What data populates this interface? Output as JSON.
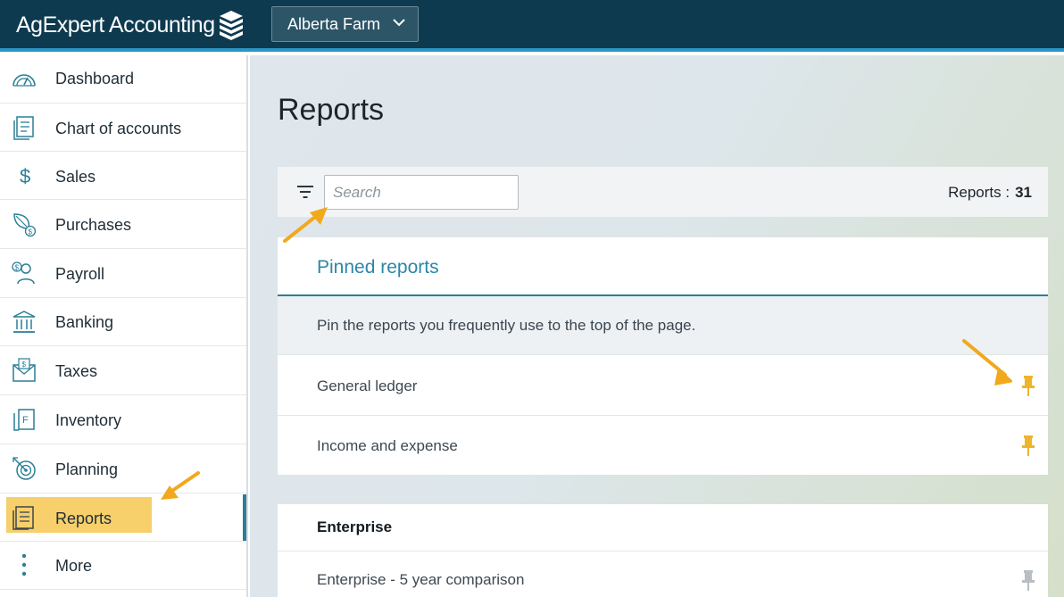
{
  "app": {
    "name": "AgExpert Accounting",
    "farm": "Alberta Farm"
  },
  "sidebar": {
    "items": [
      {
        "label": "Dashboard",
        "icon": "speedometer-icon"
      },
      {
        "label": "Chart of accounts",
        "icon": "document-list-icon"
      },
      {
        "label": "Sales",
        "icon": "dollar-icon"
      },
      {
        "label": "Purchases",
        "icon": "leaf-dollar-icon"
      },
      {
        "label": "Payroll",
        "icon": "person-dollar-icon"
      },
      {
        "label": "Banking",
        "icon": "bank-icon"
      },
      {
        "label": "Taxes",
        "icon": "envelope-dollar-icon"
      },
      {
        "label": "Inventory",
        "icon": "inventory-icon"
      },
      {
        "label": "Planning",
        "icon": "target-icon"
      },
      {
        "label": "Reports",
        "icon": "report-icon",
        "active": true
      },
      {
        "label": "More",
        "icon": "vertical-dots-icon"
      }
    ]
  },
  "main": {
    "title": "Reports",
    "search": {
      "placeholder": "Search"
    },
    "count_label": "Reports :",
    "count_value": "31",
    "pinned": {
      "title": "Pinned reports",
      "hint": "Pin the reports you frequently use to the top of the page.",
      "rows": [
        {
          "name": "General ledger",
          "pinned": true
        },
        {
          "name": "Income and expense",
          "pinned": true
        }
      ]
    },
    "enterprise": {
      "title": "Enterprise",
      "rows": [
        {
          "name": "Enterprise - 5 year comparison",
          "pinned": false
        }
      ]
    }
  },
  "colors": {
    "topbar": "#0d3a4f",
    "accent": "#2a96c4",
    "active_highlight": "#f7cf6b",
    "pin_active": "#f0b429",
    "pin_inactive": "#b9bec2",
    "arrow": "#f2a81d"
  }
}
